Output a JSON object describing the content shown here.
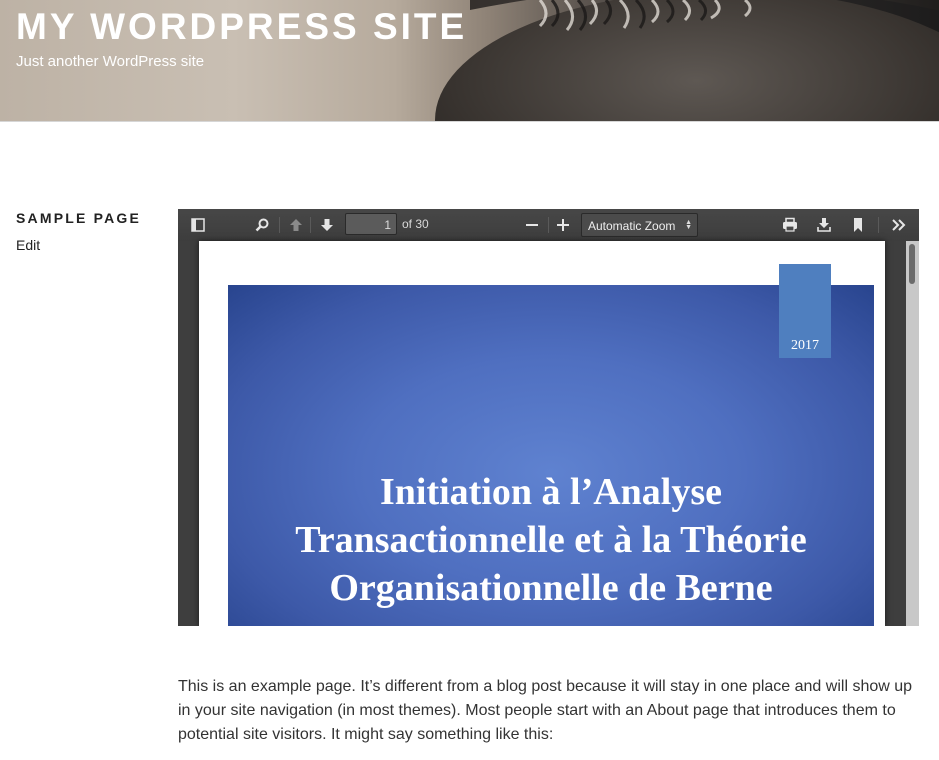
{
  "header": {
    "site_title": "My WordPress Site",
    "site_description": "Just another WordPress site"
  },
  "sidebar": {
    "page_title": "Sample Page",
    "edit_label": "Edit"
  },
  "pdf_viewer": {
    "current_page": "1",
    "page_count_label": "of 30",
    "zoom": "Automatic Zoom",
    "icons": [
      "sidebar-toggle-icon",
      "search-icon",
      "previous-page-icon",
      "next-page-icon",
      "zoom-out-icon",
      "zoom-in-icon",
      "print-icon",
      "download-icon",
      "bookmark-icon",
      "tools-icon"
    ],
    "slide": {
      "title": "Initiation à l’Analyse Transactionnelle et à la Théorie Organisationnelle de Berne",
      "title_lines": [
        "Initiation à l’Analyse",
        "Transactionnelle et à la Théorie",
        "Organisationnelle de Berne"
      ],
      "year": "2017",
      "colors": {
        "background": "#4f6fc0",
        "year_tab": "#4f7fbf"
      }
    }
  },
  "content": {
    "paragraph": "This is an example page. It’s different from a blog post because it will stay in one place and will show up in your site navigation (in most themes). Most people start with an About page that introduces them to potential site visitors. It might say something like this:"
  }
}
